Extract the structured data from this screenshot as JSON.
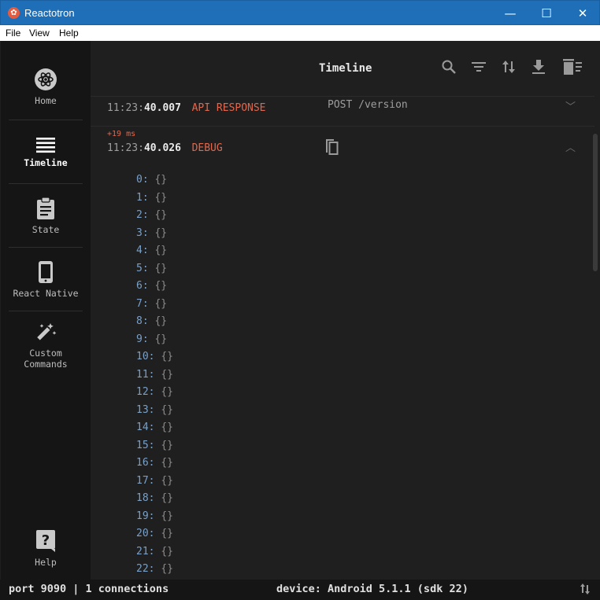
{
  "window": {
    "title": "Reactotron",
    "minimize_glyph": "—",
    "maximize_glyph": "☐",
    "close_glyph": "✕"
  },
  "menu": [
    "File",
    "View",
    "Help"
  ],
  "sidebar": {
    "items": [
      {
        "label": "Home",
        "icon": "reactotron-logo-icon",
        "active": false
      },
      {
        "label": "Timeline",
        "icon": "timeline-icon",
        "active": true
      },
      {
        "label": "State",
        "icon": "clipboard-icon",
        "active": false
      },
      {
        "label": "React Native",
        "icon": "phone-icon",
        "active": false
      },
      {
        "label": "Custom Commands",
        "label_lines": [
          "Custom",
          "Commands"
        ],
        "icon": "magic-wand-icon",
        "active": false
      }
    ],
    "help": {
      "label": "Help",
      "icon": "help-icon"
    }
  },
  "header": {
    "title": "Timeline",
    "tools": [
      "search-icon",
      "filter-icon",
      "sort-icon",
      "download-icon",
      "clear-icon"
    ]
  },
  "timeline": [
    {
      "time_prefix": "11:23:",
      "time_main": "40.007",
      "type": "API RESPONSE",
      "subtitle": "POST /version",
      "expanded": false
    },
    {
      "delta": "+19 ms",
      "time_prefix": "11:23:",
      "time_main": "40.026",
      "type": "DEBUG",
      "expanded": true,
      "entries": [
        {
          "key": "0:",
          "value": "{}"
        },
        {
          "key": "1:",
          "value": "{}"
        },
        {
          "key": "2:",
          "value": "{}"
        },
        {
          "key": "3:",
          "value": "{}"
        },
        {
          "key": "4:",
          "value": "{}"
        },
        {
          "key": "5:",
          "value": "{}"
        },
        {
          "key": "6:",
          "value": "{}"
        },
        {
          "key": "7:",
          "value": "{}"
        },
        {
          "key": "8:",
          "value": "{}"
        },
        {
          "key": "9:",
          "value": "{}"
        },
        {
          "key": "10:",
          "value": "{}"
        },
        {
          "key": "11:",
          "value": "{}"
        },
        {
          "key": "12:",
          "value": "{}"
        },
        {
          "key": "13:",
          "value": "{}"
        },
        {
          "key": "14:",
          "value": "{}"
        },
        {
          "key": "15:",
          "value": "{}"
        },
        {
          "key": "16:",
          "value": "{}"
        },
        {
          "key": "17:",
          "value": "{}"
        },
        {
          "key": "18:",
          "value": "{}"
        },
        {
          "key": "19:",
          "value": "{}"
        },
        {
          "key": "20:",
          "value": "{}"
        },
        {
          "key": "21:",
          "value": "{}"
        },
        {
          "key": "22:",
          "value": "{}"
        }
      ]
    }
  ],
  "status": {
    "port": "port 9090 | 1 connections",
    "device": "device: Android 5.1.1 (sdk 22)",
    "icon": "swap-vertical-icon"
  },
  "colors": {
    "accent": "#e3674c",
    "titlebar": "#1e6fb8",
    "background": "#1f1f1f",
    "sidebar": "#151515",
    "key": "#7aa0c8"
  }
}
